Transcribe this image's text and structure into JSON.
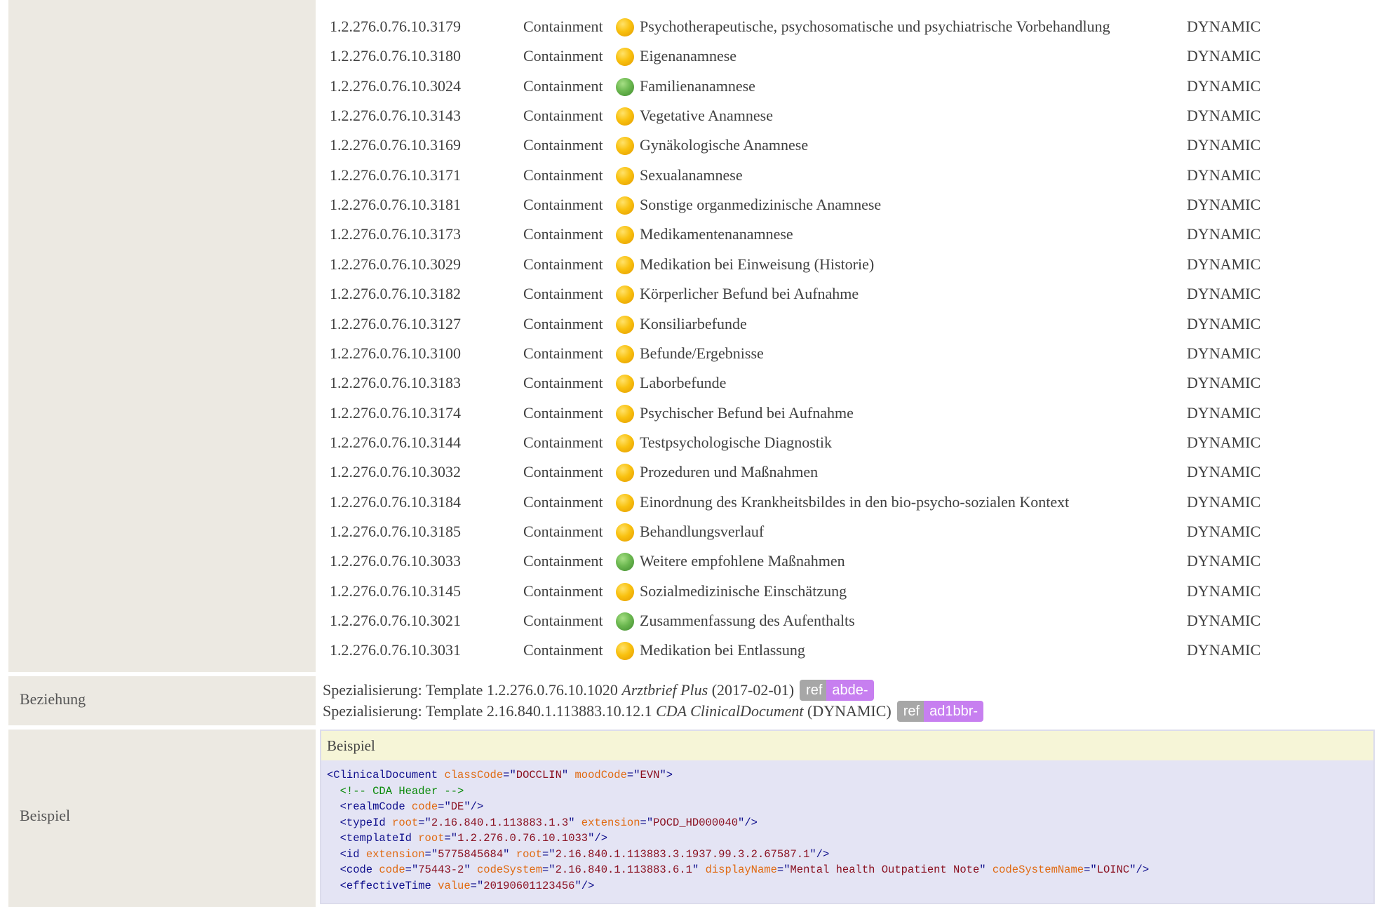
{
  "contains_table": {
    "rows": [
      {
        "oid": "1.2.276.0.76.10.3179",
        "relation": "Containment",
        "status": "yellow",
        "name": "Psychotherapeutische, psychosomatische und psychiatrische Vorbehandlung",
        "flexibility": "DYNAMIC"
      },
      {
        "oid": "1.2.276.0.76.10.3180",
        "relation": "Containment",
        "status": "yellow",
        "name": "Eigenanamnese",
        "flexibility": "DYNAMIC"
      },
      {
        "oid": "1.2.276.0.76.10.3024",
        "relation": "Containment",
        "status": "green",
        "name": "Familienanamnese",
        "flexibility": "DYNAMIC"
      },
      {
        "oid": "1.2.276.0.76.10.3143",
        "relation": "Containment",
        "status": "yellow",
        "name": "Vegetative Anamnese",
        "flexibility": "DYNAMIC"
      },
      {
        "oid": "1.2.276.0.76.10.3169",
        "relation": "Containment",
        "status": "yellow",
        "name": "Gynäkologische Anamnese",
        "flexibility": "DYNAMIC"
      },
      {
        "oid": "1.2.276.0.76.10.3171",
        "relation": "Containment",
        "status": "yellow",
        "name": "Sexualanamnese",
        "flexibility": "DYNAMIC"
      },
      {
        "oid": "1.2.276.0.76.10.3181",
        "relation": "Containment",
        "status": "yellow",
        "name": "Sonstige organmedizinische Anamnese",
        "flexibility": "DYNAMIC"
      },
      {
        "oid": "1.2.276.0.76.10.3173",
        "relation": "Containment",
        "status": "yellow",
        "name": "Medikamentenanamnese",
        "flexibility": "DYNAMIC"
      },
      {
        "oid": "1.2.276.0.76.10.3029",
        "relation": "Containment",
        "status": "yellow",
        "name": "Medikation bei Einweisung (Historie)",
        "flexibility": "DYNAMIC"
      },
      {
        "oid": "1.2.276.0.76.10.3182",
        "relation": "Containment",
        "status": "yellow",
        "name": "Körperlicher Befund bei Aufnahme",
        "flexibility": "DYNAMIC"
      },
      {
        "oid": "1.2.276.0.76.10.3127",
        "relation": "Containment",
        "status": "yellow",
        "name": "Konsiliarbefunde",
        "flexibility": "DYNAMIC"
      },
      {
        "oid": "1.2.276.0.76.10.3100",
        "relation": "Containment",
        "status": "yellow",
        "name": "Befunde/Ergebnisse",
        "flexibility": "DYNAMIC"
      },
      {
        "oid": "1.2.276.0.76.10.3183",
        "relation": "Containment",
        "status": "yellow",
        "name": "Laborbefunde",
        "flexibility": "DYNAMIC"
      },
      {
        "oid": "1.2.276.0.76.10.3174",
        "relation": "Containment",
        "status": "yellow",
        "name": "Psychischer Befund bei Aufnahme",
        "flexibility": "DYNAMIC"
      },
      {
        "oid": "1.2.276.0.76.10.3144",
        "relation": "Containment",
        "status": "yellow",
        "name": "Testpsychologische Diagnostik",
        "flexibility": "DYNAMIC"
      },
      {
        "oid": "1.2.276.0.76.10.3032",
        "relation": "Containment",
        "status": "yellow",
        "name": "Prozeduren und Maßnahmen",
        "flexibility": "DYNAMIC"
      },
      {
        "oid": "1.2.276.0.76.10.3184",
        "relation": "Containment",
        "status": "yellow",
        "name": "Einordnung des Krankheitsbildes in den bio-psycho-sozialen Kontext",
        "flexibility": "DYNAMIC"
      },
      {
        "oid": "1.2.276.0.76.10.3185",
        "relation": "Containment",
        "status": "yellow",
        "name": "Behandlungsverlauf",
        "flexibility": "DYNAMIC"
      },
      {
        "oid": "1.2.276.0.76.10.3033",
        "relation": "Containment",
        "status": "green",
        "name": "Weitere empfohlene Maßnahmen",
        "flexibility": "DYNAMIC"
      },
      {
        "oid": "1.2.276.0.76.10.3145",
        "relation": "Containment",
        "status": "yellow",
        "name": "Sozialmedizinische Einschätzung",
        "flexibility": "DYNAMIC"
      },
      {
        "oid": "1.2.276.0.76.10.3021",
        "relation": "Containment",
        "status": "green",
        "name": "Zusammenfassung des Aufenthalts",
        "flexibility": "DYNAMIC"
      },
      {
        "oid": "1.2.276.0.76.10.3031",
        "relation": "Containment",
        "status": "yellow",
        "name": "Medikation bei Entlassung",
        "flexibility": "DYNAMIC"
      }
    ]
  },
  "beziehung": {
    "label": "Beziehung",
    "items": [
      {
        "prefix": "Spezialisierung: Template 1.2.276.0.76.10.1020 ",
        "template_name": "Arztbrief Plus",
        "suffix": " (2017-02-01)",
        "ref_key": "ref",
        "ref_value": "abde-"
      },
      {
        "prefix": "Spezialisierung: Template 2.16.840.1.113883.10.12.1 ",
        "template_name": "CDA ClinicalDocument",
        "suffix": " (DYNAMIC)",
        "ref_key": "ref",
        "ref_value": "ad1bbr-"
      }
    ]
  },
  "beispiel": {
    "label": "Beispiel",
    "box_title": "Beispiel",
    "code_lines": [
      [
        {
          "t": "tag",
          "s": "<ClinicalDocument "
        },
        {
          "t": "attr",
          "s": "classCode"
        },
        {
          "t": "tag",
          "s": "=\""
        },
        {
          "t": "val",
          "s": "DOCCLIN"
        },
        {
          "t": "tag",
          "s": "\" "
        },
        {
          "t": "attr",
          "s": "moodCode"
        },
        {
          "t": "tag",
          "s": "=\""
        },
        {
          "t": "val",
          "s": "EVN"
        },
        {
          "t": "tag",
          "s": "\">"
        }
      ],
      [
        {
          "t": "com",
          "s": "  <!-- CDA Header -->"
        }
      ],
      [
        {
          "t": "tag",
          "s": "  <realmCode "
        },
        {
          "t": "attr",
          "s": "code"
        },
        {
          "t": "tag",
          "s": "=\""
        },
        {
          "t": "val",
          "s": "DE"
        },
        {
          "t": "tag",
          "s": "\"/>"
        }
      ],
      [
        {
          "t": "tag",
          "s": "  <typeId "
        },
        {
          "t": "attr",
          "s": "root"
        },
        {
          "t": "tag",
          "s": "=\""
        },
        {
          "t": "val",
          "s": "2.16.840.1.113883.1.3"
        },
        {
          "t": "tag",
          "s": "\" "
        },
        {
          "t": "attr",
          "s": "extension"
        },
        {
          "t": "tag",
          "s": "=\""
        },
        {
          "t": "val",
          "s": "POCD_HD000040"
        },
        {
          "t": "tag",
          "s": "\"/>"
        }
      ],
      [
        {
          "t": "tag",
          "s": "  <templateId "
        },
        {
          "t": "attr",
          "s": "root"
        },
        {
          "t": "tag",
          "s": "=\""
        },
        {
          "t": "val",
          "s": "1.2.276.0.76.10.1033"
        },
        {
          "t": "tag",
          "s": "\"/>"
        }
      ],
      [
        {
          "t": "tag",
          "s": "  <id "
        },
        {
          "t": "attr",
          "s": "extension"
        },
        {
          "t": "tag",
          "s": "=\""
        },
        {
          "t": "val",
          "s": "5775845684"
        },
        {
          "t": "tag",
          "s": "\" "
        },
        {
          "t": "attr",
          "s": "root"
        },
        {
          "t": "tag",
          "s": "=\""
        },
        {
          "t": "val",
          "s": "2.16.840.1.113883.3.1937.99.3.2.67587.1"
        },
        {
          "t": "tag",
          "s": "\"/>"
        }
      ],
      [
        {
          "t": "tag",
          "s": "  <code "
        },
        {
          "t": "attr",
          "s": "code"
        },
        {
          "t": "tag",
          "s": "=\""
        },
        {
          "t": "val",
          "s": "75443-2"
        },
        {
          "t": "tag",
          "s": "\" "
        },
        {
          "t": "attr",
          "s": "codeSystem"
        },
        {
          "t": "tag",
          "s": "=\""
        },
        {
          "t": "val",
          "s": "2.16.840.1.113883.6.1"
        },
        {
          "t": "tag",
          "s": "\" "
        },
        {
          "t": "attr",
          "s": "displayName"
        },
        {
          "t": "tag",
          "s": "=\""
        },
        {
          "t": "val",
          "s": "Mental health Outpatient Note"
        },
        {
          "t": "tag",
          "s": "\" "
        },
        {
          "t": "attr",
          "s": "codeSystemName"
        },
        {
          "t": "tag",
          "s": "=\""
        },
        {
          "t": "val",
          "s": "LOINC"
        },
        {
          "t": "tag",
          "s": "\"/>"
        }
      ],
      [
        {
          "t": "tag",
          "s": "  <effectiveTime "
        },
        {
          "t": "attr",
          "s": "value"
        },
        {
          "t": "tag",
          "s": "=\""
        },
        {
          "t": "val",
          "s": "20190601123456"
        },
        {
          "t": "tag",
          "s": "\"/>"
        }
      ]
    ]
  },
  "colors": {
    "status_yellow": "#f9c10f",
    "status_green": "#6cb850",
    "ref_key_bg": "#a7a7a7",
    "ref_value_bg": "#c77ff0",
    "label_col_bg": "#ece9e2",
    "example_bg": "#e4e4f4",
    "example_head_bg": "#f6f5d7"
  }
}
